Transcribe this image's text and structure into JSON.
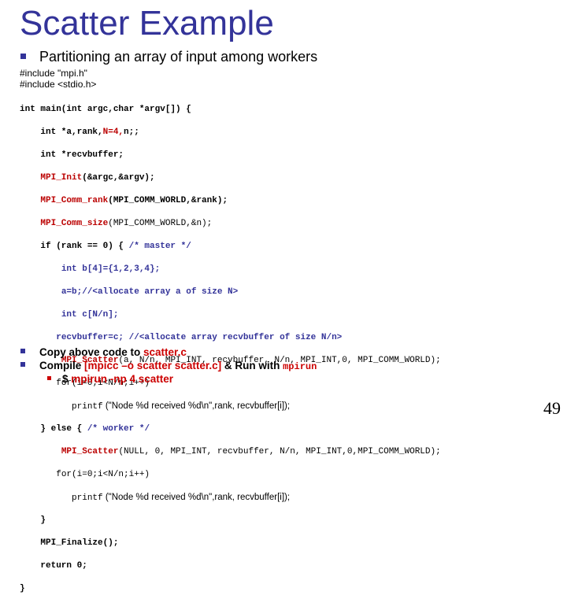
{
  "slide": {
    "title": "Scatter Example",
    "bullet": "Partitioning an array of input among workers",
    "includes": [
      "#include \"mpi.h\"",
      "#include <stdio.h>"
    ],
    "code": {
      "l1": "int main(int argc,char *argv[]) {",
      "l2a": "    int *a,rank,",
      "l2b": "N=4,",
      "l2c": "n;;",
      "l3": "    int *recvbuffer;",
      "l4a": "MPI_Init",
      "l4b": "(&argc,&argv);",
      "l5a": "MPI_Comm_rank",
      "l5b": "(MPI_COMM_WORLD,&rank);",
      "l6a": "MPI_Comm_size",
      "l6b": "(MPI_COMM_WORLD,&n);",
      "l7a": "    if (rank == 0) { ",
      "l7b": "/* master */",
      "l8": "int b[4]={1,2,3,4};",
      "l9": "a=b;//<allocate array a of size N>",
      "l10": "int c[N/n];",
      "l11": "recvbuffer=c; //<allocate array recvbuffer of size N/n>",
      "l12a": "MPI_Scatter",
      "l12b": "(a, N/n, MPI_INT, recvbuffer, N/n, MPI_INT,0, MPI_COMM_WORLD);",
      "l13": "for(i=0;i<N/n;i++)",
      "l14a": "printf",
      "l14b": " (\"Node %d received %d\\n\",rank, recvbuffer[i]);",
      "l15a": "    } else { ",
      "l15b": "/* worker */",
      "l16a": "MPI_Scatter",
      "l16b": "(NULL, 0, MPI_INT, recvbuffer, N/n, MPI_INT,0,MPI_COMM_WORLD);",
      "l17": "for(i=0;i<N/n;i++)",
      "l18a": "printf",
      "l18b": " (\"Node %d received %d\\n\",rank, recvbuffer[i]);",
      "l19": "    }",
      "l20": "    MPI_Finalize();",
      "l21": "    return 0;",
      "l22": "}"
    },
    "bottom": {
      "b1_text": "Copy above code to ",
      "b1_file": "scatter.c",
      "b2_text": "Compile ",
      "b2_cmd": "[mpicc –o scatter scatter.c]",
      "b2_mid": " & Run with ",
      "b2_run": "mpirun",
      "b3_prefix": "$ ",
      "b3_cmd": "mpirun -np 4 scatter"
    },
    "page_number": "49",
    "colors": {
      "title": "#333399",
      "keyword_red": "#bb0000",
      "comment_blue": "#333399"
    }
  }
}
